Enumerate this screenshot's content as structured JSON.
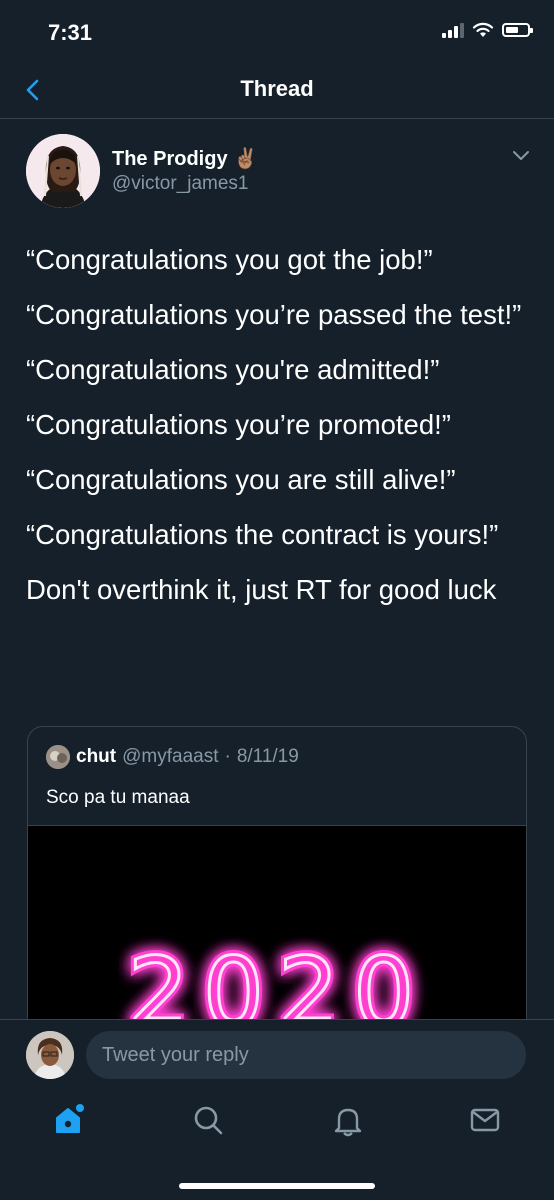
{
  "status_bar": {
    "time": "7:31"
  },
  "nav": {
    "title": "Thread"
  },
  "tweet": {
    "author_name": "The Prodigy ✌🏽",
    "handle": "@victor_james1",
    "lines": [
      "“Congratulations you got the job!”",
      "“Congratulations you’re passed the test!”",
      "“Congratulations you're admitted!”",
      "“Congratulations you’re promoted!”",
      "“Congratulations you are still alive!”",
      "“Congratulations the contract is yours!”",
      "Don't overthink it, just RT for good luck"
    ]
  },
  "quoted_tweet": {
    "name": "chut",
    "handle": "@myfaaast",
    "dot": "·",
    "date": "8/11/19",
    "text": "Sco pa tu manaa",
    "media_text": "2020"
  },
  "reply": {
    "placeholder": "Tweet your reply"
  },
  "tabs": [
    {
      "icon": "home-icon",
      "active": true
    },
    {
      "icon": "search-icon",
      "active": false
    },
    {
      "icon": "bell-icon",
      "active": false
    },
    {
      "icon": "mail-icon",
      "active": false
    }
  ],
  "colors": {
    "background": "#15202b",
    "accent": "#1da1f2",
    "secondary_text": "#8899a6",
    "divider": "#38444d",
    "neon": "#ff3fd0"
  }
}
